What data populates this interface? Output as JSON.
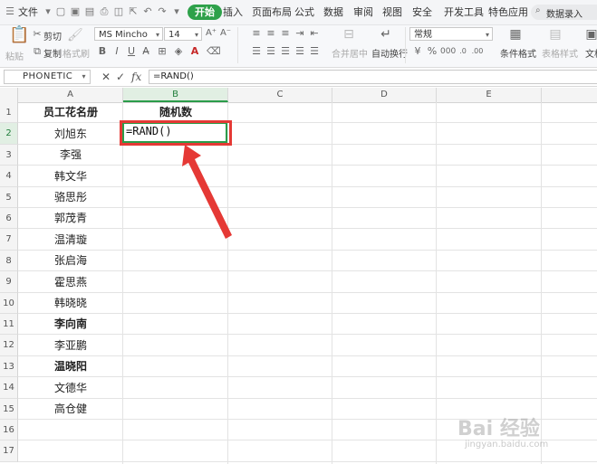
{
  "menubar": {
    "file_label": "文件",
    "tabs": [
      {
        "label": "开始",
        "active": true
      },
      {
        "label": "插入"
      },
      {
        "label": "页面布局"
      },
      {
        "label": "公式"
      },
      {
        "label": "数据"
      },
      {
        "label": "审阅"
      },
      {
        "label": "视图"
      },
      {
        "label": "安全"
      },
      {
        "label": "开发工具"
      },
      {
        "label": "特色应用"
      }
    ],
    "search_placeholder": "数据录入",
    "accent_color": "#2ea14a"
  },
  "ribbon": {
    "cut": "剪切",
    "copy": "复制",
    "paste": "粘贴",
    "format_painter": "格式刷",
    "font_name": "MS Mincho",
    "font_size": "14",
    "bold": "B",
    "italic": "I",
    "underline": "U",
    "merge_center": "合并居中",
    "wrap_text": "自动换行",
    "number_format": "常规",
    "conditional_format": "条件格式",
    "table_style": "表格样式",
    "percent": "%",
    "extra": "文档"
  },
  "formula_bar": {
    "name_box": "PHONETIC",
    "cancel_icon": "✕",
    "confirm_icon": "✓",
    "fx_label": "fx",
    "formula": "=RAND()"
  },
  "sheet": {
    "columns": [
      "A",
      "B",
      "C",
      "D",
      "E"
    ],
    "selected_column": "B",
    "rows": [
      "1",
      "2",
      "3",
      "4",
      "5",
      "6",
      "7",
      "8",
      "9",
      "10",
      "11",
      "12",
      "13",
      "14",
      "15",
      "16",
      "17"
    ],
    "selected_row": "2",
    "header_a": "员工花名册",
    "header_b": "随机数",
    "names": [
      "刘旭东",
      "李强",
      "韩文华",
      "骆思彤",
      "郭茂青",
      "温清璇",
      "张启海",
      "霍思燕",
      "韩晓晓",
      "李向南",
      "李亚鹏",
      "温晓阳",
      "文德华",
      "高仓健"
    ],
    "bold_names": [
      false,
      false,
      false,
      false,
      false,
      false,
      false,
      false,
      false,
      true,
      false,
      true,
      false,
      false
    ],
    "active_cell_text": "=RAND()",
    "active_cell_color": "#2b9c4a",
    "callout_color": "#e53935"
  },
  "watermark": {
    "main": "Bai 经验",
    "sub": "jingyan.baidu.com"
  }
}
